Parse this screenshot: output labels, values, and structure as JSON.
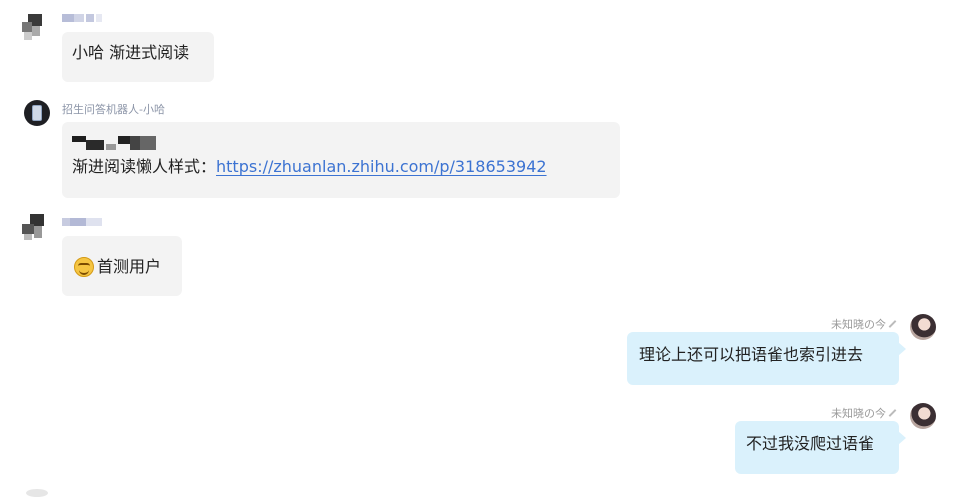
{
  "messages": [
    {
      "type": "incoming",
      "sender_name": "",
      "text": "小哈 渐进式阅读"
    },
    {
      "type": "incoming",
      "sender_name": "招生问答机器人-小哈",
      "prefix": "渐进阅读懒人样式：",
      "link": "https://zhuanlan.zhihu.com/p/318653942"
    },
    {
      "type": "incoming",
      "sender_name": "",
      "emoji": "smile-emoji",
      "text": "首测用户"
    },
    {
      "type": "outgoing",
      "sender_name": "未知晓の今",
      "text": "理论上还可以把语雀也索引进去"
    },
    {
      "type": "outgoing",
      "sender_name": "未知晓の今",
      "text": "不过我没爬过语雀"
    }
  ],
  "colors": {
    "incoming_bubble": "#f3f3f3",
    "outgoing_bubble": "#daf1fc",
    "link": "#3c73d2",
    "bot_name": "#8c95a8"
  }
}
